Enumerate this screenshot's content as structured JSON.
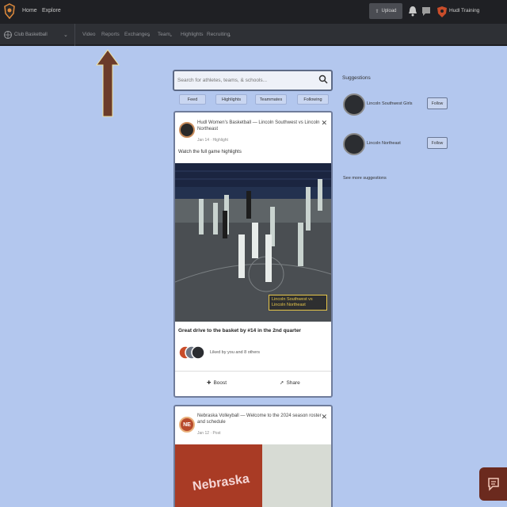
{
  "topnav": {
    "home": "Home",
    "explore": "Explore",
    "upload": "Upload",
    "team_name": "Hudl Training"
  },
  "subnav": {
    "team": "Club Basketball",
    "links": [
      "Video",
      "Reports",
      "Exchanges",
      "Team",
      "Highlights",
      "Recruiting"
    ]
  },
  "search": {
    "placeholder": "Search for athletes, teams, & schools..."
  },
  "filters": [
    "Feed",
    "Highlights",
    "Teammates",
    "Following"
  ],
  "feed": {
    "post1": {
      "headline": "Hudl Women's Basketball — Lincoln Southwest vs Lincoln Northeast",
      "meta": "Jan 14 · Highlight",
      "caption": "Watch the full game highlights",
      "video_tag": "Lincoln Southwest vs Lincoln Northeast",
      "title": "Great drive to the basket by #14 in the 2nd quarter",
      "reactions": "Liked by you and 8 others",
      "boost": "Boost",
      "share": "Share"
    },
    "post2": {
      "avatar": "NE",
      "headline": "Nebraska Volleyball — Welcome to the 2024 season roster and schedule",
      "meta": "Jan 12 · Post",
      "image_word": "Nebraska"
    }
  },
  "suggestions": {
    "title": "Suggestions",
    "items": [
      {
        "name": "Lincoln Southwest Girls",
        "action": "Follow"
      },
      {
        "name": "Lincoln Northeast",
        "action": "Follow"
      }
    ],
    "more": "See more suggestions"
  },
  "colors": {
    "nav_bg": "#1f2024",
    "subnav_bg": "#2e3035",
    "page_bg": "#b3c7ee",
    "accent": "#c94d2a"
  }
}
